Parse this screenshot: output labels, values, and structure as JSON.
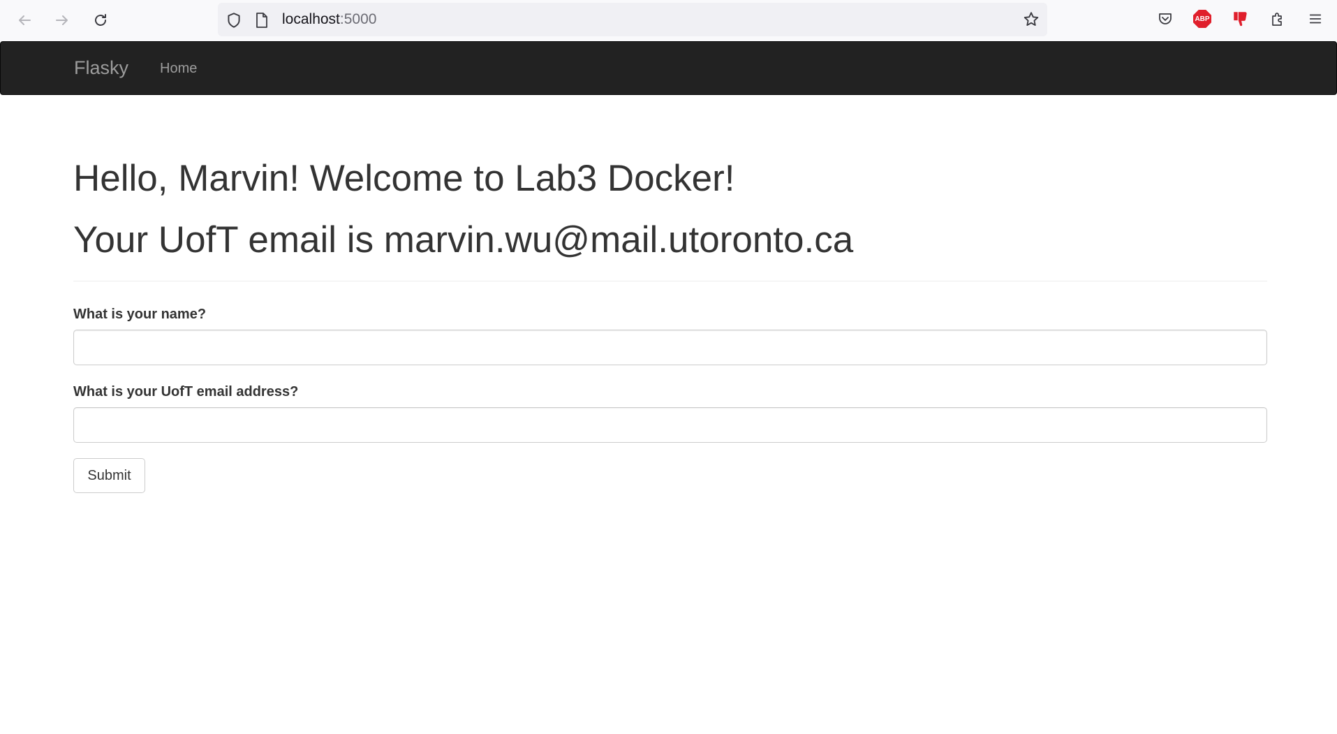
{
  "browser": {
    "url_host": "localhost",
    "url_port": ":5000",
    "icons": [
      "back-arrow-icon",
      "forward-arrow-icon",
      "reload-icon",
      "shield-icon",
      "page-icon",
      "bookmark-star-icon",
      "pocket-icon",
      "adblock-plus-icon",
      "thumbs-down-extension-icon",
      "extensions-puzzle-icon",
      "hamburger-menu-icon"
    ],
    "adblock_text": "ABP"
  },
  "navbar": {
    "brand": "Flasky",
    "links": [
      {
        "label": "Home"
      }
    ],
    "background": "#222222",
    "text_color": "#9d9d9d"
  },
  "main": {
    "greeting": "Hello, Marvin! Welcome to Lab3 Docker!",
    "email_line": "Your UofT email is marvin.wu@mail.utoronto.ca",
    "form": {
      "name_label": "What is your name?",
      "name_value": "",
      "email_label": "What is your UofT email address?",
      "email_value": "",
      "submit_label": "Submit"
    }
  },
  "colors": {
    "accent_red": "#e01f2c",
    "text": "#333333"
  }
}
